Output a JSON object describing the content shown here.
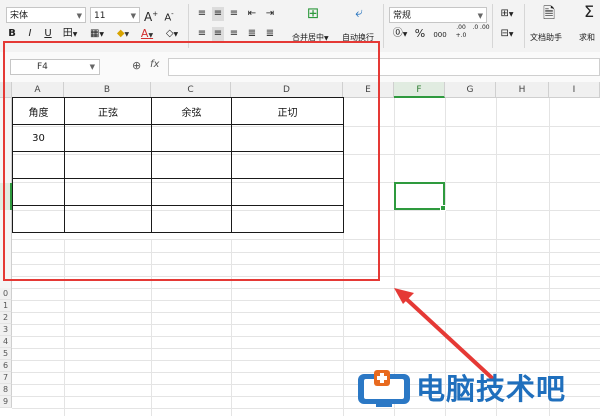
{
  "ribbon": {
    "font_name": "宋体",
    "font_size": "11",
    "bold": "B",
    "italic": "I",
    "underline": "U",
    "merge_center_label": "合并居中",
    "wrap_label": "自动换行",
    "number_format": "常规",
    "percent_symbol": "%",
    "thousand_symbol": "000",
    "inc_decimal": ".00 +.0",
    "dec_decimal": ".0 .00",
    "table_helper_label": "文档助手",
    "sum_label": "求和"
  },
  "formula_bar": {
    "name_box": "F4",
    "fx_label": "fx",
    "content": ""
  },
  "grid": {
    "columns": [
      "A",
      "B",
      "C",
      "D",
      "E",
      "F",
      "G",
      "H",
      "I"
    ],
    "selected_column": "F",
    "row_numbers": [
      "0",
      "1",
      "2",
      "3",
      "4",
      "5",
      "6",
      "7",
      "8",
      "9"
    ]
  },
  "table": {
    "headers": [
      "角度",
      "正弦",
      "余弦",
      "正切"
    ],
    "rows": [
      [
        "30",
        "",
        "",
        ""
      ],
      [
        "",
        "",
        "",
        ""
      ],
      [
        "",
        "",
        "",
        ""
      ],
      [
        "",
        "",
        "",
        ""
      ]
    ]
  },
  "watermark": {
    "text": "电脑技术吧"
  },
  "colors": {
    "annotation_red": "#e53935",
    "selection_green": "#2e9a3e",
    "brand_blue": "#1f6fbd"
  }
}
